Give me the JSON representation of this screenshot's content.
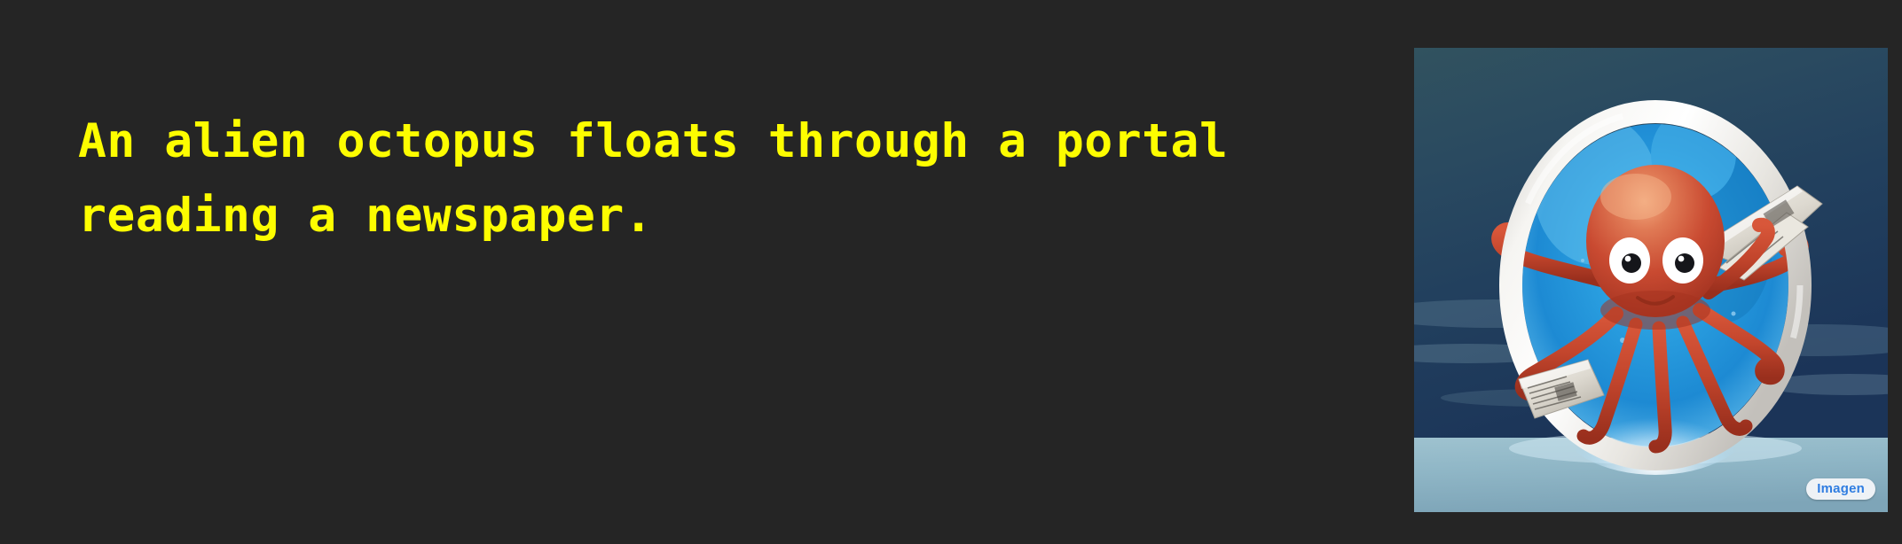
{
  "page": {
    "background_color": "#252525"
  },
  "caption": {
    "text_color": "#FDFD00",
    "line1": "An alien octopus floats through a portal",
    "line2": "reading a newspaper."
  },
  "image": {
    "alt": "An alien octopus floats through a portal reading a newspaper.",
    "watermark_badge": "Imagen",
    "badge_text_color": "#2f7de1",
    "badge_background_color": "#eef2f6",
    "scene": {
      "sky_color_top": "#2c4f66",
      "sky_color_mid": "#1d3a59",
      "ground_color": "#8fb4c4",
      "portal_ring_color": "#f2f0ee",
      "portal_interior_color": "#1a9bdc",
      "octopus_body_color": "#c6452f",
      "newspaper_color": "#e9e6df"
    }
  }
}
